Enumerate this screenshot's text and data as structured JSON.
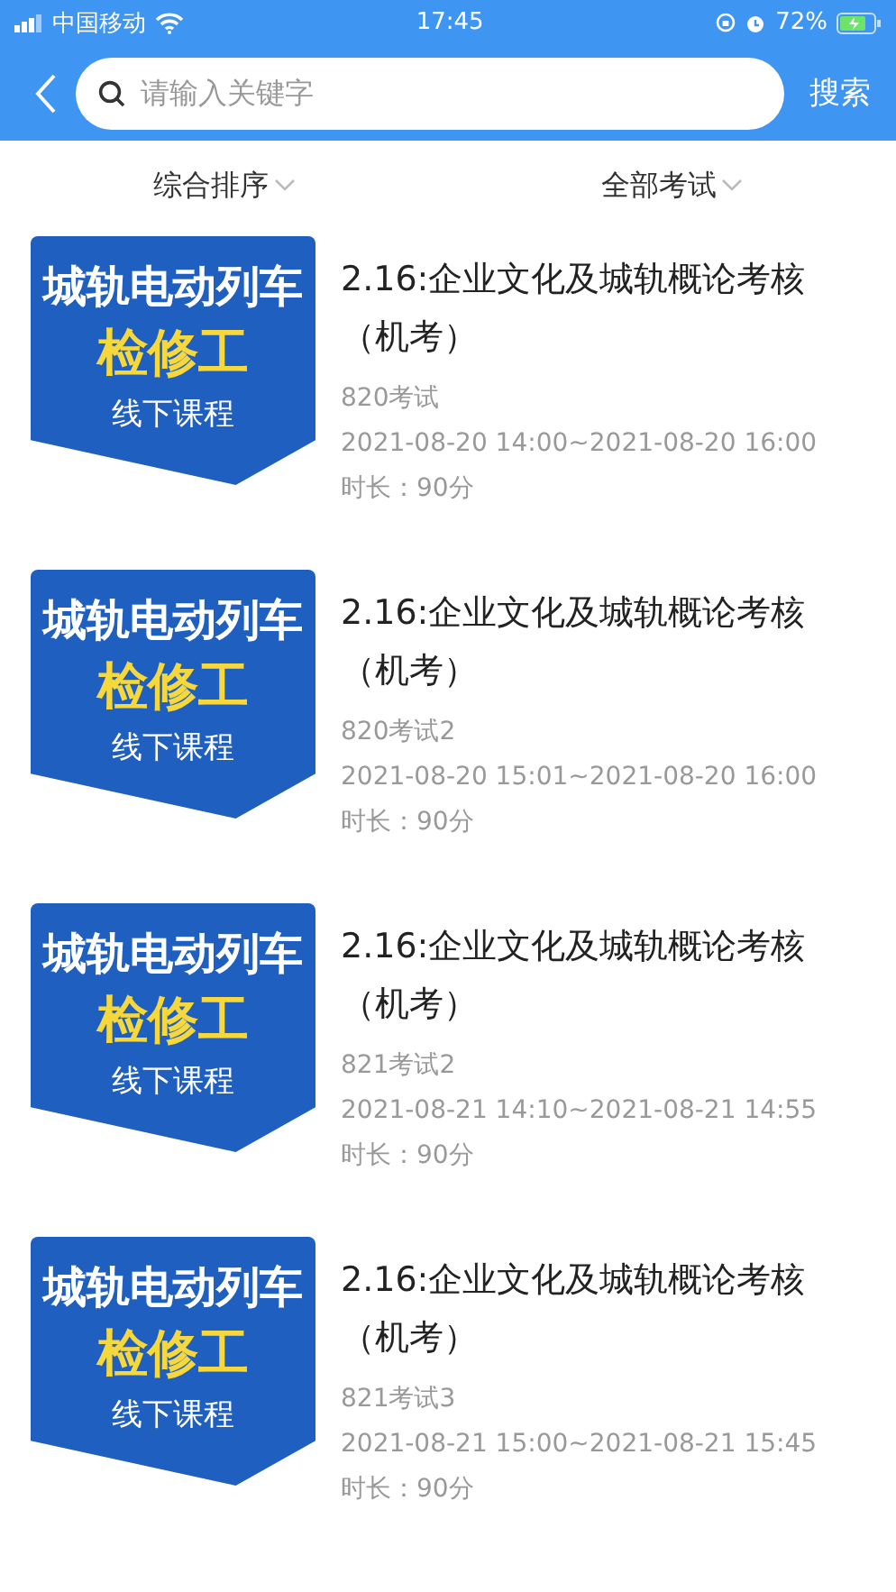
{
  "status_bar": {
    "carrier": "中国移动",
    "time": "17:45",
    "battery": "72%"
  },
  "header": {
    "search": {
      "placeholder": "请输入关键字"
    },
    "search_button": "搜索"
  },
  "filters": [
    {
      "label": "综合排序"
    },
    {
      "label": "全部考试"
    }
  ],
  "exams": [
    {
      "cover": {
        "line_1": "城轨电动列车",
        "line_2": "检修工",
        "line_3": "线下课程"
      },
      "title": "2.16:企业文化及城轨概论考核（机考）",
      "name": "820考试",
      "time": "2021-08-20 14:00~2021-08-20 16:00",
      "duration": "时长：90分"
    },
    {
      "cover": {
        "line_1": "城轨电动列车",
        "line_2": "检修工",
        "line_3": "线下课程"
      },
      "title": "2.16:企业文化及城轨概论考核（机考）",
      "name": "820考试2",
      "time": "2021-08-20 15:01~2021-08-20 16:00",
      "duration": "时长：90分"
    },
    {
      "cover": {
        "line_1": "城轨电动列车",
        "line_2": "检修工",
        "line_3": "线下课程"
      },
      "title": "2.16:企业文化及城轨概论考核（机考）",
      "name": "821考试2",
      "time": "2021-08-21 14:10~2021-08-21 14:55",
      "duration": "时长：90分"
    },
    {
      "cover": {
        "line_1": "城轨电动列车",
        "line_2": "检修工",
        "line_3": "线下课程"
      },
      "title": "2.16:企业文化及城轨概论考核（机考）",
      "name": "821考试3",
      "time": "2021-08-21 15:00~2021-08-21 15:45",
      "duration": "时长：90分"
    }
  ]
}
